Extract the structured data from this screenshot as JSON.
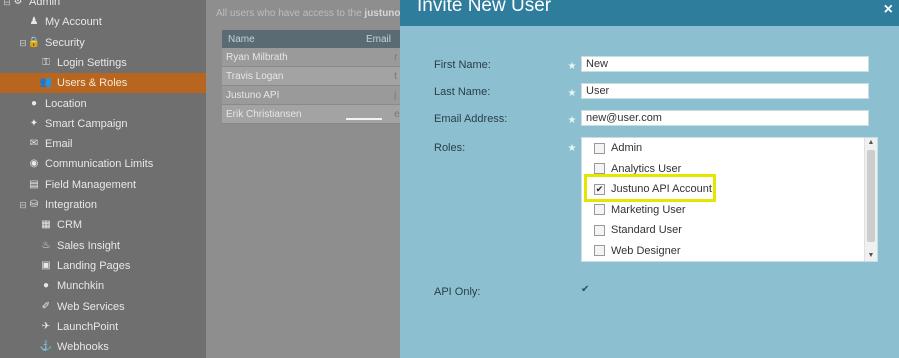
{
  "sidebar": {
    "items": [
      {
        "label": "Admin",
        "icon": "admin-icon",
        "glyph": "⚙",
        "expander": "⊟",
        "indent": 0,
        "selected": false
      },
      {
        "label": "My Account",
        "icon": "person-icon",
        "glyph": "♟",
        "expander": "",
        "indent": 1,
        "selected": false
      },
      {
        "label": "Security",
        "icon": "lock-icon",
        "glyph": "🔒",
        "expander": "⊟",
        "indent": 1,
        "selected": false
      },
      {
        "label": "Login Settings",
        "icon": "key-icon",
        "glyph": "⚿",
        "expander": "",
        "indent": 2,
        "selected": false
      },
      {
        "label": "Users & Roles",
        "icon": "users-icon",
        "glyph": "👥",
        "expander": "",
        "indent": 2,
        "selected": true
      },
      {
        "label": "Location",
        "icon": "location-icon",
        "glyph": "●",
        "expander": "",
        "indent": 1,
        "selected": false
      },
      {
        "label": "Smart Campaign",
        "icon": "lightbulb-icon",
        "glyph": "✦",
        "expander": "",
        "indent": 1,
        "selected": false
      },
      {
        "label": "Email",
        "icon": "email-icon",
        "glyph": "✉",
        "expander": "",
        "indent": 1,
        "selected": false
      },
      {
        "label": "Communication Limits",
        "icon": "limits-icon",
        "glyph": "◉",
        "expander": "",
        "indent": 1,
        "selected": false
      },
      {
        "label": "Field Management",
        "icon": "field-icon",
        "glyph": "▤",
        "expander": "",
        "indent": 1,
        "selected": false
      },
      {
        "label": "Integration",
        "icon": "integration-icon",
        "glyph": "⛁",
        "expander": "⊟",
        "indent": 1,
        "selected": false
      },
      {
        "label": "CRM",
        "icon": "crm-icon",
        "glyph": "▦",
        "expander": "",
        "indent": 2,
        "selected": false
      },
      {
        "label": "Sales Insight",
        "icon": "sales-insight-icon",
        "glyph": "♨",
        "expander": "",
        "indent": 2,
        "selected": false
      },
      {
        "label": "Landing Pages",
        "icon": "landing-pages-icon",
        "glyph": "▣",
        "expander": "",
        "indent": 2,
        "selected": false
      },
      {
        "label": "Munchkin",
        "icon": "munchkin-icon",
        "glyph": "●",
        "expander": "",
        "indent": 2,
        "selected": false
      },
      {
        "label": "Web Services",
        "icon": "web-services-icon",
        "glyph": "✐",
        "expander": "",
        "indent": 2,
        "selected": false
      },
      {
        "label": "LaunchPoint",
        "icon": "launchpoint-icon",
        "glyph": "✈",
        "expander": "",
        "indent": 2,
        "selected": false
      },
      {
        "label": "Webhooks",
        "icon": "webhooks-icon",
        "glyph": "⚓",
        "expander": "",
        "indent": 2,
        "selected": false
      }
    ]
  },
  "user_panel": {
    "hint_prefix": "All users who have access to the",
    "hint_bold": "justunodev",
    "columns": [
      "Name",
      "Email"
    ],
    "rows": [
      {
        "name": "Ryan Milbrath",
        "email": "r"
      },
      {
        "name": "Travis Logan",
        "email": "t"
      },
      {
        "name": "Justuno API",
        "email": "j"
      },
      {
        "name": "Erik Christiansen",
        "email": "e"
      }
    ]
  },
  "modal": {
    "title": "Invite New User",
    "close_glyph": "×",
    "required_glyph": "★",
    "fields": {
      "first_name": {
        "label": "First Name:",
        "value": "New"
      },
      "last_name": {
        "label": "Last Name:",
        "value": "User"
      },
      "email": {
        "label": "Email Address:",
        "value": "new@user.com"
      }
    },
    "roles_label": "Roles:",
    "roles": [
      {
        "label": "Admin",
        "checked": false
      },
      {
        "label": "Analytics User",
        "checked": false
      },
      {
        "label": "Justuno API Account",
        "checked": true
      },
      {
        "label": "Marketing User",
        "checked": false
      },
      {
        "label": "Standard User",
        "checked": false
      },
      {
        "label": "Web Designer",
        "checked": false
      }
    ],
    "check_glyph": "✔",
    "api_only": {
      "label": "API Only:",
      "checked": true,
      "glyph": "✔"
    },
    "highlight_color": "#e5e600"
  },
  "colors": {
    "modal_header": "#2f7d9c",
    "modal_body": "#8cbfd0",
    "sidebar_selected": "#b8661f"
  }
}
